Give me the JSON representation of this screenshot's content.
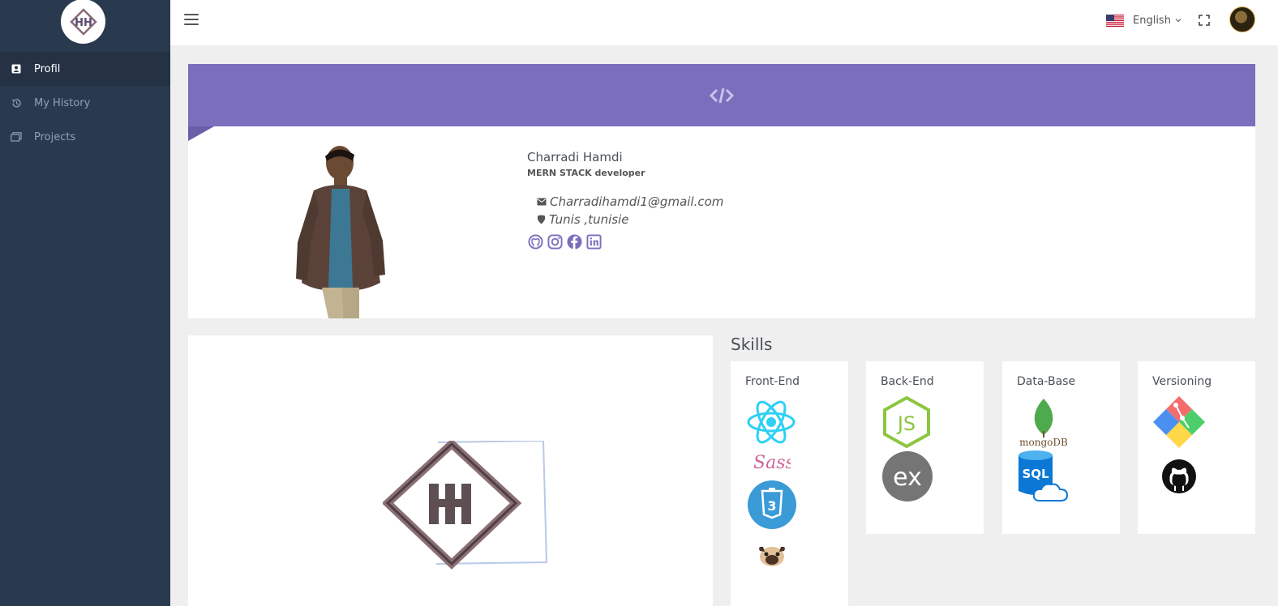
{
  "sidebar": {
    "items": [
      {
        "label": "Profil",
        "icon": "profile-icon",
        "active": true
      },
      {
        "label": "My History",
        "icon": "history-icon",
        "active": false
      },
      {
        "label": "Projects",
        "icon": "projects-icon",
        "active": false
      }
    ]
  },
  "topbar": {
    "language": "English",
    "flag": "us-flag-icon"
  },
  "profile": {
    "banner_icon": "code-icon",
    "name": "Charradi Hamdi",
    "role": "MERN STACK developer",
    "email": "Charradihamdi1@gmail.com",
    "location": "Tunis ,tunisie",
    "socials": [
      "github-icon",
      "instagram-icon",
      "facebook-icon",
      "linkedin-icon"
    ]
  },
  "skills": {
    "title": "Skills",
    "categories": [
      {
        "label": "Front-End",
        "icons": [
          "react-icon",
          "sass-icon",
          "css3-icon",
          "pug-icon"
        ]
      },
      {
        "label": "Back-End",
        "icons": [
          "nodejs-icon",
          "express-icon"
        ]
      },
      {
        "label": "Data-Base",
        "icons": [
          "mongodb-icon",
          "azure-sql-icon"
        ]
      },
      {
        "label": "Versioning",
        "icons": [
          "git-icon",
          "github-icon"
        ]
      }
    ],
    "mongodb_text": "mongoDB",
    "sql_text": "SQL",
    "express_text": "ex",
    "sass_text": "Sass",
    "css_text": "3",
    "js_text": "JS"
  },
  "colors": {
    "sidebar_bg": "#2a3a4e",
    "accent": "#7b6ebd",
    "react": "#2ed0f5",
    "node": "#8cc63f",
    "css3": "#3a9bd6"
  }
}
